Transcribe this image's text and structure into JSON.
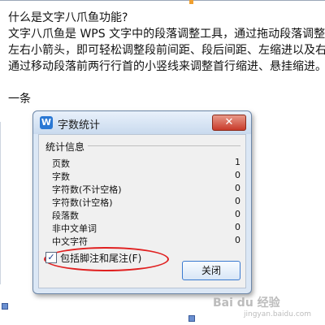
{
  "document": {
    "lines": [
      "什么是文字八爪鱼功能?",
      "文字八爪鱼是 WPS 文字中的段落调整工具，通过拖动段落调整框",
      "左右小箭头，即可轻松调整段前间距、段后间距、左缩进以及右",
      "通过移动段落前两行行首的小竖线来调整首行缩进、悬挂缩进。"
    ],
    "footer_line": "一条"
  },
  "dialog": {
    "title": "字数统计",
    "close_glyph": "✕",
    "app_icon_letter": "W",
    "group_label": "统计信息",
    "stats": [
      {
        "label": "页数",
        "value": "1"
      },
      {
        "label": "字数",
        "value": "0"
      },
      {
        "label": "字符数(不计空格)",
        "value": "0"
      },
      {
        "label": "字符数(计空格)",
        "value": "0"
      },
      {
        "label": "段落数",
        "value": "0"
      },
      {
        "label": "非中文单词",
        "value": "0"
      },
      {
        "label": "中文字符",
        "value": "0"
      }
    ],
    "checkbox": {
      "label": "包括脚注和尾注(F)",
      "checked": true,
      "check_glyph": "✓"
    },
    "ok_label": "关闭"
  },
  "watermark": {
    "text": "Bai du 经验",
    "sub": "jingyan.baidu.com"
  },
  "colors": {
    "accent": "#2a78d4",
    "highlight": "#e02020",
    "dialog_bg": "#dbe7f5"
  }
}
